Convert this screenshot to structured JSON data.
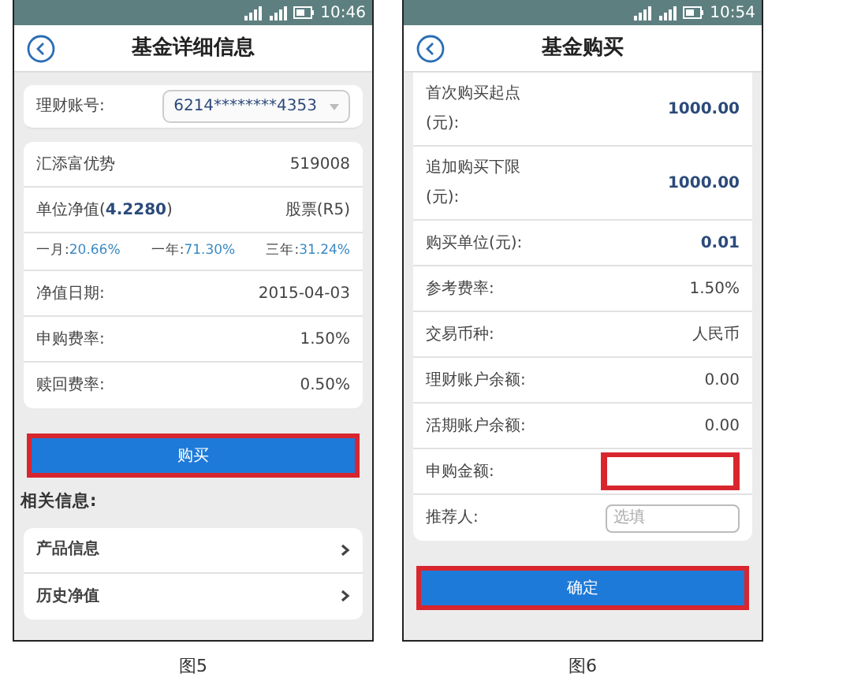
{
  "screen_5": {
    "status_time": "10:46",
    "title": "基金详细信息",
    "account": {
      "label": "理财账号:",
      "value": "6214********4353"
    },
    "fund": {
      "name": "汇添富优势",
      "code": "519008",
      "nav": "单位净值(**4.2280**)",
      "risk": "股票(R5)"
    },
    "returns": [
      {
        "label": "一月:",
        "value": "20.66%"
      },
      {
        "label": "一年:",
        "value": "71.30%"
      },
      {
        "label": "三年:",
        "value": "31.24%"
      }
    ],
    "rows": [
      {
        "label": "净值日期:",
        "value": "2015-04-03"
      },
      {
        "label": "申购费率:",
        "value": "1.50%"
      },
      {
        "label": "赎回费率:",
        "value": "0.50%"
      }
    ],
    "button": {
      "label": "购买",
      "highlighted": true
    },
    "section_title": "相关信息:",
    "links": [
      {
        "label": "产品信息"
      },
      {
        "label": "历史净值"
      }
    ],
    "caption": "图5"
  },
  "screen_6": {
    "status_time": "10:54",
    "title": "基金购买",
    "rows": [
      {
        "label": "首次购买起点(元):",
        "value": "1000.00",
        "emphasis": true
      },
      {
        "label": "追加购买下限(元):",
        "value": "1000.00",
        "emphasis": true
      },
      {
        "label": "购买单位(元):",
        "value": "0.01",
        "emphasis": true
      },
      {
        "label": "参考费率:",
        "value": "1.50%",
        "emphasis": false
      },
      {
        "label": "交易币种:",
        "value": "人民币",
        "emphasis": false
      },
      {
        "label": "理财账户余额:",
        "value": "0.00",
        "emphasis": false
      },
      {
        "label": "活期账户余额:",
        "value": "0.00",
        "emphasis": false
      }
    ],
    "fields": [
      {
        "label": "申购金额:",
        "highlighted": true
      },
      {
        "label": "推荐人:",
        "placeholder": "选填",
        "highlighted": false
      }
    ],
    "button": {
      "label": "确定",
      "highlighted": true
    },
    "caption": "图6"
  }
}
